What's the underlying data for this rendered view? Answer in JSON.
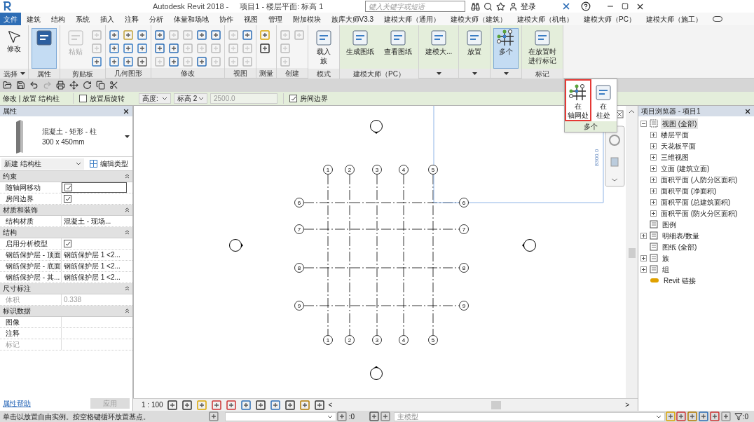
{
  "title_bar": {
    "title": "Autodesk Revit 2018 -",
    "document": "项目1 - 楼层平面: 标高 1",
    "search_placeholder": "键入关键字或短语",
    "login": "登录"
  },
  "tabs": [
    {
      "label": "文件",
      "kind": "app"
    },
    {
      "label": "建筑",
      "kind": "tab"
    },
    {
      "label": "结构",
      "kind": "tab"
    },
    {
      "label": "系统",
      "kind": "tab"
    },
    {
      "label": "插入",
      "kind": "tab"
    },
    {
      "label": "注释",
      "kind": "tab"
    },
    {
      "label": "分析",
      "kind": "tab"
    },
    {
      "label": "体量和场地",
      "kind": "tab"
    },
    {
      "label": "协作",
      "kind": "tab"
    },
    {
      "label": "视图",
      "kind": "tab"
    },
    {
      "label": "管理",
      "kind": "tab"
    },
    {
      "label": "附加模块",
      "kind": "tab"
    },
    {
      "label": "族库大师V3.3",
      "kind": "tab"
    },
    {
      "label": "建模大师（通用）",
      "kind": "tab"
    },
    {
      "label": "建模大师（建筑）",
      "kind": "tab"
    },
    {
      "label": "建模大师（机电）",
      "kind": "tab"
    },
    {
      "label": "建模大师（PC）",
      "kind": "tab"
    },
    {
      "label": "建模大师（施工）",
      "kind": "tab"
    }
  ],
  "ribbon": [
    {
      "label": "选择",
      "kind": "core",
      "dropdown": true,
      "buttons": [
        {
          "lines": [
            "修改"
          ],
          "selected": false,
          "disabled": false
        }
      ]
    },
    {
      "label": "属性",
      "kind": "core",
      "dropdown": false,
      "buttons": [
        {
          "selected": true,
          "disabled": false
        }
      ]
    },
    {
      "label": "剪贴板",
      "kind": "core",
      "dropdown": false,
      "buttons": [
        {
          "lines": [
            "粘贴"
          ],
          "selected": false,
          "disabled": true
        }
      ]
    },
    {
      "label": "几何图形",
      "kind": "core",
      "dropdown": false
    },
    {
      "label": "修改",
      "kind": "core",
      "dropdown": false
    },
    {
      "label": "视图",
      "kind": "core",
      "dropdown": false
    },
    {
      "label": "测量",
      "kind": "core",
      "dropdown": false
    },
    {
      "label": "创建",
      "kind": "core",
      "dropdown": false
    },
    {
      "label": "模式",
      "kind": "core",
      "dropdown": false,
      "buttons": [
        {
          "lines": [
            "载入",
            "族"
          ],
          "selected": false,
          "disabled": false
        }
      ]
    },
    {
      "label": "建模大师（PC）",
      "kind": "addin",
      "dropdown": false,
      "buttons": [
        {
          "lines": [
            "生成图纸"
          ],
          "selected": false,
          "disabled": false
        },
        {
          "lines": [
            "查看图纸"
          ],
          "selected": false,
          "disabled": false
        }
      ]
    },
    {
      "kind": "addin",
      "dropdown": true,
      "buttons": [
        {
          "lines": [
            "建模大..."
          ],
          "selected": false,
          "disabled": false
        }
      ]
    },
    {
      "kind": "addin",
      "dropdown": true,
      "buttons": [
        {
          "lines": [
            "放置"
          ],
          "selected": false,
          "disabled": false
        }
      ]
    },
    {
      "kind": "addin",
      "dropdown": true,
      "buttons": [
        {
          "lines": [
            "多个"
          ],
          "selected": true,
          "disabled": false
        }
      ]
    },
    {
      "label": "标记",
      "kind": "addin",
      "dropdown": false,
      "buttons": [
        {
          "lines": [
            "在放置时",
            "进行标记"
          ],
          "selected": false,
          "disabled": false
        }
      ]
    }
  ],
  "dropdown_menu": {
    "items": [
      {
        "lines": [
          "在",
          "轴网处"
        ],
        "selected": true
      },
      {
        "lines": [
          "在",
          "柱处"
        ],
        "selected": false
      }
    ],
    "footer": "多个"
  },
  "options_bar": {
    "context": "修改 | 放置 结构柱",
    "rotate": {
      "label": "放置后旋转",
      "checked": false
    },
    "height_mode": "高度:",
    "level": "标高 2",
    "offset": {
      "value": "2500.0",
      "disabled": true
    },
    "room_bounding": {
      "label": "房间边界",
      "checked": true
    }
  },
  "properties": {
    "title": "属性",
    "type_name": "混凝土 - 矩形 - 柱",
    "type_size": "300 x 450mm",
    "instance": "新建 结构柱",
    "edit_type": "编辑类型",
    "groups": [
      {
        "name": "约束",
        "rows": [
          {
            "label": "随轴网移动",
            "kind": "check",
            "checked": true,
            "disabled": false
          },
          {
            "label": "房间边界",
            "kind": "check",
            "checked": true,
            "disabled": false
          }
        ]
      },
      {
        "name": "材质和装饰",
        "rows": [
          {
            "label": "结构材质",
            "kind": "text",
            "value": "混凝土 - 现场...",
            "disabled": false
          }
        ]
      },
      {
        "name": "结构",
        "rows": [
          {
            "label": "启用分析模型",
            "kind": "check",
            "checked": true,
            "disabled": false
          },
          {
            "label": "钢筋保护层 - 顶面",
            "kind": "text",
            "value": "钢筋保护层 1 <2...",
            "disabled": false
          },
          {
            "label": "钢筋保护层 - 底面",
            "kind": "text",
            "value": "钢筋保护层 1 <2...",
            "disabled": false
          },
          {
            "label": "钢筋保护层 - 其...",
            "kind": "text",
            "value": "钢筋保护层 1 <2...",
            "disabled": false
          }
        ]
      },
      {
        "name": "尺寸标注",
        "rows": [
          {
            "label": "体积",
            "kind": "text",
            "value": "0.338",
            "disabled": true
          }
        ]
      },
      {
        "name": "标识数据",
        "rows": [
          {
            "label": "图像",
            "kind": "text",
            "disabled": false
          },
          {
            "label": "注释",
            "kind": "text",
            "disabled": false
          },
          {
            "label": "标记",
            "kind": "text",
            "disabled": true
          }
        ]
      }
    ],
    "help": "属性帮助",
    "apply": "应用"
  },
  "canvas": {
    "top_bubbles": [
      "1",
      "2",
      "3",
      "4",
      "5"
    ],
    "bottom_bubbles": [
      "1",
      "2",
      "3",
      "4",
      "5"
    ],
    "left_bubbles": [
      "6",
      "7",
      "8",
      "9"
    ],
    "right_bubbles": [
      "6",
      "7",
      "8",
      "9"
    ],
    "dimension": "8300.0"
  },
  "view_bar": {
    "scale": "1 : 100",
    "scroll_left": "<",
    "scroll_right": ">"
  },
  "browser": {
    "title": "项目浏览器 - 项目1",
    "tree": [
      {
        "label": "视图 (全部)",
        "kind": "views",
        "selected": true,
        "expanded": true,
        "children": [
          {
            "label": "楼层平面",
            "kind": "node",
            "selected": false,
            "expanded": false
          },
          {
            "label": "天花板平面",
            "kind": "node",
            "selected": false,
            "expanded": false
          },
          {
            "label": "三维视图",
            "kind": "node",
            "selected": false,
            "expanded": false
          },
          {
            "label": "立面 (建筑立面)",
            "kind": "node",
            "selected": false,
            "expanded": false
          },
          {
            "label": "面积平面 (人防分区面积)",
            "kind": "node",
            "selected": false,
            "expanded": false
          },
          {
            "label": "面积平面 (净面积)",
            "kind": "node",
            "selected": false,
            "expanded": false
          },
          {
            "label": "面积平面 (总建筑面积)",
            "kind": "node",
            "selected": false,
            "expanded": false
          },
          {
            "label": "面积平面 (防火分区面积)",
            "kind": "node",
            "selected": false,
            "expanded": false
          }
        ]
      },
      {
        "label": "图例",
        "kind": "legend",
        "selected": false
      },
      {
        "label": "明细表/数量",
        "kind": "schedule",
        "selected": false,
        "expanded": false
      },
      {
        "label": "图纸 (全部)",
        "kind": "sheet",
        "selected": false
      },
      {
        "label": "族",
        "kind": "family",
        "selected": false,
        "expanded": false
      },
      {
        "label": "组",
        "kind": "group",
        "selected": false,
        "expanded": false
      },
      {
        "label": "Revit 链接",
        "kind": "link",
        "selected": false
      }
    ]
  },
  "status_bar": {
    "message": "单击以放置自由实例。按空格键循环放置基点。",
    "workset_count": ":0",
    "design_option": "主模型",
    "filter_count": ":0"
  }
}
